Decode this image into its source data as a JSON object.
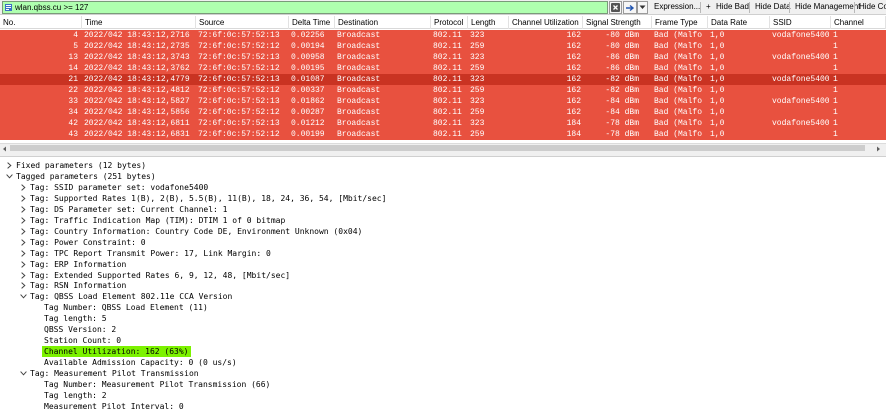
{
  "filter": {
    "value": "wlan.qbss.cu >= 127",
    "buttons": {
      "expression": "Expression...",
      "hide_bad": "Hide Bad",
      "hide_data": "Hide Data",
      "hide_management": "Hide Management",
      "hide_control": "Hide Contr"
    },
    "plus_label": "+"
  },
  "packet_list": {
    "columns": [
      "No.",
      "Time",
      "Source",
      "Delta Time",
      "Destination",
      "Protocol",
      "Length",
      "Channel Utilization",
      "Signal Strength",
      "Frame Type",
      "Data Rate",
      "SSID",
      "Channel"
    ],
    "rows": [
      {
        "no": "4",
        "time": "2022/042 18:43:12,2716",
        "source": "72:6f:0c:57:52:13",
        "delta": "0.02256",
        "destination": "Broadcast",
        "protocol": "802.11",
        "length": "323",
        "cu": "162",
        "signal": "-80 dBm",
        "frame_type": "Bad (Malfo",
        "rate": "1,0",
        "ssid": "vodafone5400",
        "channel": "1"
      },
      {
        "no": "5",
        "time": "2022/042 18:43:12,2735",
        "source": "72:6f:0c:57:52:12",
        "delta": "0.00194",
        "destination": "Broadcast",
        "protocol": "802.11",
        "length": "259",
        "cu": "162",
        "signal": "-80 dBm",
        "frame_type": "Bad (Malfo",
        "rate": "1,0",
        "ssid": "",
        "channel": "1"
      },
      {
        "no": "13",
        "time": "2022/042 18:43:12,3743",
        "source": "72:6f:0c:57:52:13",
        "delta": "0.00958",
        "destination": "Broadcast",
        "protocol": "802.11",
        "length": "323",
        "cu": "162",
        "signal": "-86 dBm",
        "frame_type": "Bad (Malfo",
        "rate": "1,0",
        "ssid": "vodafone5400",
        "channel": "1"
      },
      {
        "no": "14",
        "time": "2022/042 18:43:12,3762",
        "source": "72:6f:0c:57:52:12",
        "delta": "0.00195",
        "destination": "Broadcast",
        "protocol": "802.11",
        "length": "259",
        "cu": "162",
        "signal": "-86 dBm",
        "frame_type": "Bad (Malfo",
        "rate": "1,0",
        "ssid": "",
        "channel": "1"
      },
      {
        "no": "21",
        "time": "2022/042 18:43:12,4779",
        "source": "72:6f:0c:57:52:13",
        "delta": "0.01087",
        "destination": "Broadcast",
        "protocol": "802.11",
        "length": "323",
        "cu": "162",
        "signal": "-82 dBm",
        "frame_type": "Bad (Malfo",
        "rate": "1,0",
        "ssid": "vodafone5400",
        "channel": "1"
      },
      {
        "no": "22",
        "time": "2022/042 18:43:12,4812",
        "source": "72:6f:0c:57:52:12",
        "delta": "0.00337",
        "destination": "Broadcast",
        "protocol": "802.11",
        "length": "259",
        "cu": "162",
        "signal": "-82 dBm",
        "frame_type": "Bad (Malfo",
        "rate": "1,0",
        "ssid": "",
        "channel": "1"
      },
      {
        "no": "33",
        "time": "2022/042 18:43:12,5827",
        "source": "72:6f:0c:57:52:13",
        "delta": "0.01862",
        "destination": "Broadcast",
        "protocol": "802.11",
        "length": "323",
        "cu": "162",
        "signal": "-84 dBm",
        "frame_type": "Bad (Malfo",
        "rate": "1,0",
        "ssid": "vodafone5400",
        "channel": "1"
      },
      {
        "no": "34",
        "time": "2022/042 18:43:12,5856",
        "source": "72:6f:0c:57:52:12",
        "delta": "0.00287",
        "destination": "Broadcast",
        "protocol": "802.11",
        "length": "259",
        "cu": "162",
        "signal": "-84 dBm",
        "frame_type": "Bad (Malfo",
        "rate": "1,0",
        "ssid": "",
        "channel": "1"
      },
      {
        "no": "42",
        "time": "2022/042 18:43:12,6811",
        "source": "72:6f:0c:57:52:13",
        "delta": "0.01212",
        "destination": "Broadcast",
        "protocol": "802.11",
        "length": "323",
        "cu": "184",
        "signal": "-78 dBm",
        "frame_type": "Bad (Malfo",
        "rate": "1,0",
        "ssid": "vodafone5400",
        "channel": "1"
      },
      {
        "no": "43",
        "time": "2022/042 18:43:12,6831",
        "source": "72:6f:0c:57:52:12",
        "delta": "0.00199",
        "destination": "Broadcast",
        "protocol": "802.11",
        "length": "259",
        "cu": "184",
        "signal": "-78 dBm",
        "frame_type": "Bad (Malfo",
        "rate": "1,0",
        "ssid": "",
        "channel": "1"
      }
    ],
    "selected_index": 4,
    "row_color": "#e8513f",
    "selected_row_color": "#c93322"
  },
  "details": {
    "highlight_color": "#7cf200",
    "highlighted_index": 17,
    "lines": [
      {
        "text": "Fixed parameters (12 bytes)",
        "level": 0,
        "toggle": "collapsed"
      },
      {
        "text": "Tagged parameters (251 bytes)",
        "level": 0,
        "toggle": "expanded"
      },
      {
        "text": "Tag: SSID parameter set: vodafone5400",
        "level": 1,
        "toggle": "collapsed"
      },
      {
        "text": "Tag: Supported Rates 1(B), 2(B), 5.5(B), 11(B), 18, 24, 36, 54, [Mbit/sec]",
        "level": 1,
        "toggle": "collapsed"
      },
      {
        "text": "Tag: DS Parameter set: Current Channel: 1",
        "level": 1,
        "toggle": "collapsed"
      },
      {
        "text": "Tag: Traffic Indication Map (TIM): DTIM 1 of 0 bitmap",
        "level": 1,
        "toggle": "collapsed"
      },
      {
        "text": "Tag: Country Information: Country Code DE, Environment Unknown (0x04)",
        "level": 1,
        "toggle": "collapsed"
      },
      {
        "text": "Tag: Power Constraint: 0",
        "level": 1,
        "toggle": "collapsed"
      },
      {
        "text": "Tag: TPC Report Transmit Power: 17, Link Margin: 0",
        "level": 1,
        "toggle": "collapsed"
      },
      {
        "text": "Tag: ERP Information",
        "level": 1,
        "toggle": "collapsed"
      },
      {
        "text": "Tag: Extended Supported Rates 6, 9, 12, 48, [Mbit/sec]",
        "level": 1,
        "toggle": "collapsed"
      },
      {
        "text": "Tag: RSN Information",
        "level": 1,
        "toggle": "collapsed"
      },
      {
        "text": "Tag: QBSS Load Element 802.11e CCA Version",
        "level": 1,
        "toggle": "expanded"
      },
      {
        "text": "Tag Number: QBSS Load Element (11)",
        "level": 2,
        "toggle": "none"
      },
      {
        "text": "Tag length: 5",
        "level": 2,
        "toggle": "none"
      },
      {
        "text": "QBSS Version: 2",
        "level": 2,
        "toggle": "none"
      },
      {
        "text": "Station Count: 0",
        "level": 2,
        "toggle": "none"
      },
      {
        "text": "Channel Utilization: 162 (63%)",
        "level": 2,
        "toggle": "none"
      },
      {
        "text": "Available Admission Capacity: 0 (0 us/s)",
        "level": 2,
        "toggle": "none"
      },
      {
        "text": "Tag: Measurement Pilot Transmission",
        "level": 1,
        "toggle": "expanded"
      },
      {
        "text": "Tag Number: Measurement Pilot Transmission (66)",
        "level": 2,
        "toggle": "none"
      },
      {
        "text": "Tag length: 2",
        "level": 2,
        "toggle": "none"
      },
      {
        "text": "Measurement Pilot Interval: 0",
        "level": 2,
        "toggle": "none"
      }
    ]
  },
  "icons": {
    "filter": "bookmark-filter-icon",
    "clear": "clear-x-icon",
    "apply": "apply-arrow-icon",
    "dropdown": "chevron-down-icon",
    "expand": "chevron-right-icon",
    "collapse": "chevron-down-icon"
  }
}
